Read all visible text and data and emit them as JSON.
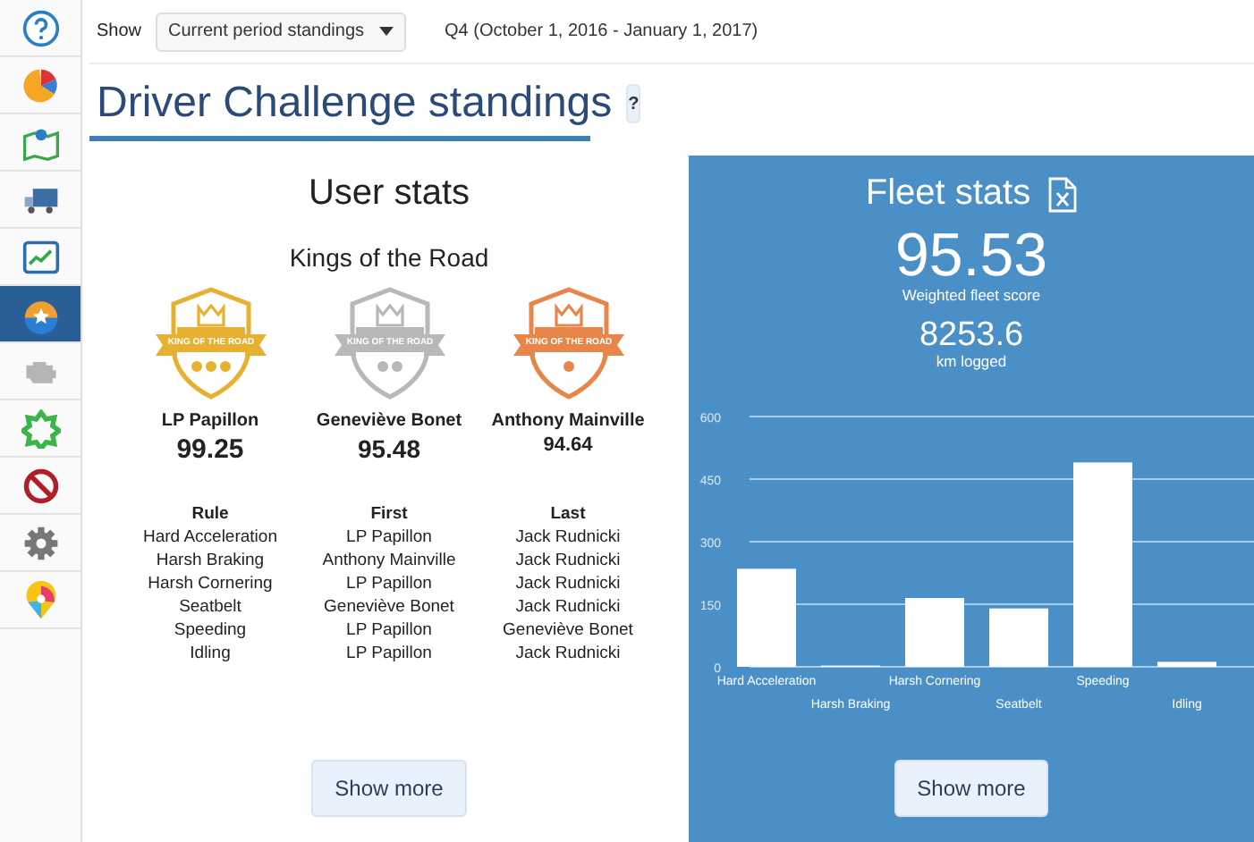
{
  "sidebar": {
    "items": [
      {
        "kind": "help",
        "selected": false
      },
      {
        "kind": "pie",
        "selected": false
      },
      {
        "kind": "map",
        "selected": false
      },
      {
        "kind": "truck",
        "selected": false
      },
      {
        "kind": "chart",
        "selected": false
      },
      {
        "kind": "badge",
        "selected": true
      },
      {
        "kind": "engine",
        "selected": false
      },
      {
        "kind": "puzzle",
        "selected": false
      },
      {
        "kind": "block",
        "selected": false
      },
      {
        "kind": "gear",
        "selected": false
      },
      {
        "kind": "pin",
        "selected": false
      }
    ]
  },
  "toolbar": {
    "show_label": "Show",
    "period_select": "Current period standings",
    "period_range": "Q4 (October 1, 2016 - January 1, 2017)"
  },
  "page_title": "Driver Challenge standings",
  "help_button": "?",
  "user_stats": {
    "title": "User stats",
    "subtitle": "Kings of the Road",
    "leaders": [
      {
        "badge_text": "KING OF THE ROAD",
        "color": "#e8b030",
        "kind": "gold",
        "name": "LP Papillon",
        "score": "99.25"
      },
      {
        "badge_text": "KING OF THE ROAD",
        "color": "#b8b8b8",
        "kind": "silver",
        "name": "Geneviève Bonet",
        "score": "95.48"
      },
      {
        "badge_text": "KING OF THE ROAD",
        "color": "#e8864a",
        "kind": "bronze",
        "name": "Anthony Mainville",
        "score": "94.64"
      }
    ],
    "table": {
      "columns": [
        "Rule",
        "First",
        "Last"
      ],
      "rows": [
        [
          "Hard Acceleration",
          "LP Papillon",
          "Jack Rudnicki"
        ],
        [
          "Harsh Braking",
          "Anthony Mainville",
          "Jack Rudnicki"
        ],
        [
          "Harsh Cornering",
          "LP Papillon",
          "Jack Rudnicki"
        ],
        [
          "Seatbelt",
          "Geneviève Bonet",
          "Jack Rudnicki"
        ],
        [
          "Speeding",
          "LP Papillon",
          "Geneviève Bonet"
        ],
        [
          "Idling",
          "LP Papillon",
          "Jack Rudnicki"
        ]
      ]
    },
    "button": "Show more"
  },
  "fleet_stats": {
    "title": "Fleet stats",
    "score": "95.53",
    "score_label": "Weighted fleet score",
    "distance": "8253.6",
    "distance_label": "km logged",
    "chart_data": {
      "type": "bar",
      "categories": [
        "Hard Acceleration",
        "Harsh Braking",
        "Harsh Cornering",
        "Seatbelt",
        "Speeding",
        "Idling"
      ],
      "values": [
        235,
        3,
        165,
        140,
        490,
        12
      ],
      "ylim": [
        0,
        600
      ],
      "yticks": [
        0,
        150,
        300,
        450,
        600
      ],
      "grid": true
    },
    "button": "Show more"
  }
}
